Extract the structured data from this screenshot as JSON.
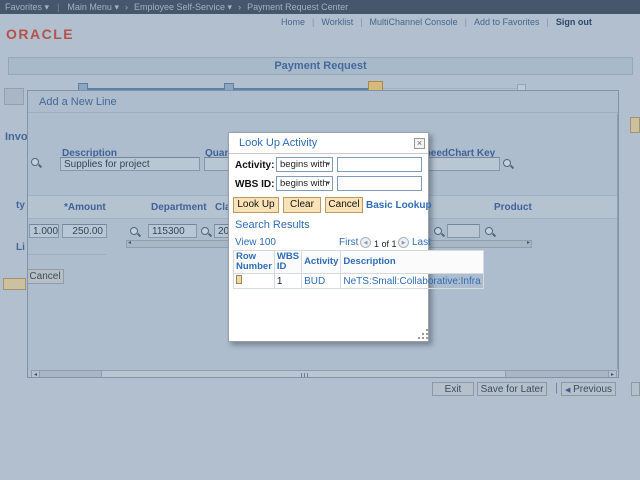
{
  "colors": {
    "oracle_red": "#b6524a",
    "link_blue": "#2e6cb8",
    "dialog_button_tan": "#fbe3b7",
    "current_step_tan": "#d6ba79",
    "page_dim_bg": "#b1bfce"
  },
  "icons": {
    "caret_down": "▾",
    "chevron": "›",
    "prev_arrow": "◀",
    "pager_prev": "◀",
    "pager_next": "▶",
    "scroll_up": "▴",
    "scroll_down": "▾",
    "scroll_left": "◂",
    "scroll_right": "▸",
    "close": "×"
  },
  "topbar": {
    "favorites": "Favorites",
    "main_menu": "Main Menu",
    "employee_self_service": "Employee Self-Service",
    "payment_request_center": "Payment Request Center"
  },
  "portal": {
    "home": "Home",
    "worklist": "Worklist",
    "multichannel": "MultiChannel Console",
    "add_to_favorites": "Add to Favorites",
    "sign_out": "Sign out"
  },
  "logo": "ORACLE",
  "page": {
    "title": "Payment Request",
    "fragments": {
      "invoice": "Invo",
      "quantity": "ty",
      "line": "Li"
    }
  },
  "modal": {
    "title": "Add a New Line",
    "fields": {
      "description_label": "Description",
      "description_value": "Supplies for project",
      "quantity_label": "Quantity",
      "quantity_value": "1.000",
      "speedchart_label": "SpeedChart Key",
      "speedchart_value": ""
    },
    "grid": {
      "headers": {
        "amount": "*Amount",
        "department": "Department",
        "class": "Class",
        "product": "Product"
      },
      "row": {
        "quantity": "1.0000",
        "amount": "250.00",
        "department": "115300",
        "class_value": "20",
        "product": ""
      }
    },
    "cancel_label": "Cancel"
  },
  "lookup": {
    "title": "Look Up Activity",
    "activity_label": "Activity:",
    "wbs_label": "WBS ID:",
    "activity_operator": "begins with",
    "wbs_operator": "begins with",
    "activity_value": "",
    "wbs_value": "",
    "buttons": {
      "look_up": "Look Up",
      "clear": "Clear",
      "cancel": "Cancel"
    },
    "basic_lookup": "Basic Lookup",
    "results_heading": "Search Results",
    "view_link": "View 100",
    "pager": {
      "first": "First",
      "counter": "1 of 1",
      "last": "Last"
    },
    "table": {
      "headers": {
        "row_number": "Row Number",
        "wbs_id": "WBS ID",
        "activity": "Activity",
        "description": "Description"
      },
      "rows": [
        {
          "wbs_id": "1",
          "activity": "BUD",
          "description": "NeTS:Small:Collaborative:Infra"
        }
      ]
    }
  },
  "footer": {
    "exit": "Exit",
    "save_for_later": "Save for Later",
    "previous": "Previous"
  }
}
